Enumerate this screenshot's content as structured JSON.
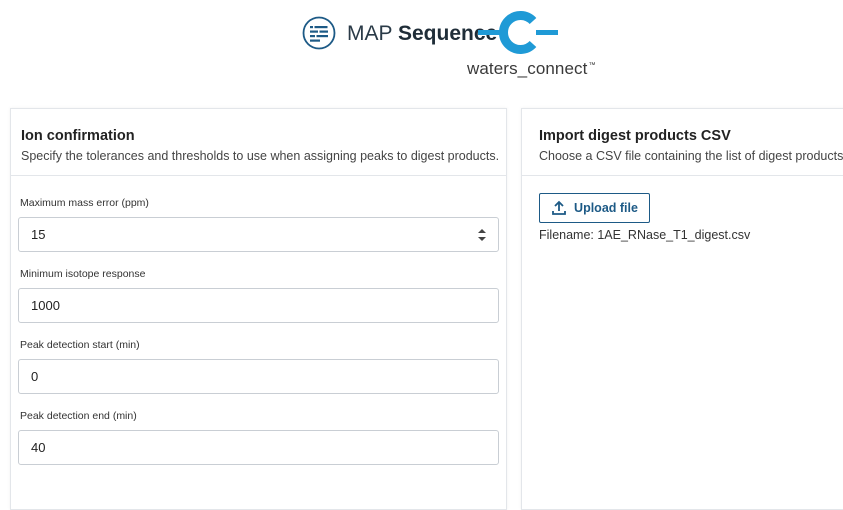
{
  "header": {
    "app_name_light": "MAP",
    "app_name_bold": "Sequence",
    "app_icon": "list-icon",
    "brand_text": "waters_connect",
    "brand_tm": "™",
    "brand_color": "#1f9ad6"
  },
  "ion_confirmation": {
    "title": "Ion confirmation",
    "subtitle": "Specify the tolerances and thresholds to use when assigning peaks to digest products.",
    "fields": [
      {
        "label": "Maximum mass error (ppm)",
        "value": "15",
        "has_stepper": true
      },
      {
        "label": "Minimum isotope response",
        "value": "1000"
      },
      {
        "label": "Peak detection start (min)",
        "value": "0"
      },
      {
        "label": "Peak detection end (min)",
        "value": "40"
      }
    ]
  },
  "import_digest": {
    "title": "Import digest products CSV",
    "subtitle": "Choose a CSV file containing the list of digest products.",
    "upload_label": "Upload file",
    "upload_icon": "upload-icon",
    "filename_text": "Filename: 1AE_RNase_T1_digest.csv"
  },
  "colors": {
    "accent": "#1d5a86",
    "border": "#c9ced4"
  }
}
